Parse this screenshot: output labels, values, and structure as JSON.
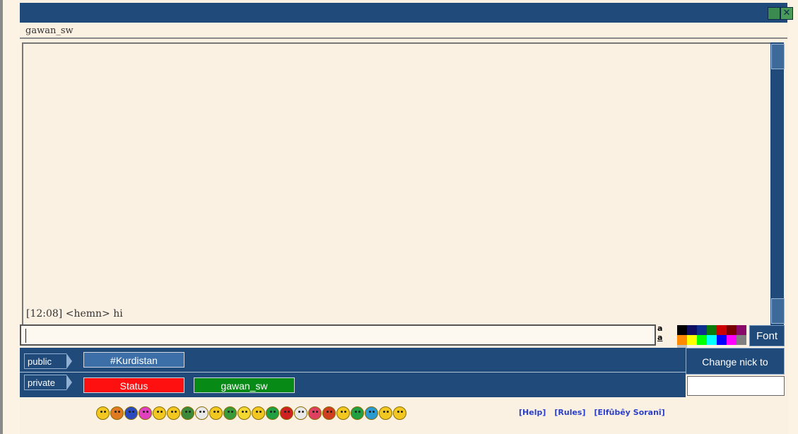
{
  "window": {
    "nick_title": "gawan_sw",
    "maximize_icon": "maximize-icon",
    "close_glyph": "✕"
  },
  "chat": {
    "lines": [
      "[12:08] <hemn> hi"
    ]
  },
  "format": {
    "aa_top": "a",
    "aa_bottom": "a",
    "font_label": "Font",
    "palette": [
      "#000000",
      "#101060",
      "#0f2f8f",
      "#0a7a0a",
      "#cc0000",
      "#7a0000",
      "#8a0a6a",
      "#ff8a00",
      "#ffff00",
      "#00ff00",
      "#00ffff",
      "#0000ff",
      "#ff00ff",
      "#808080",
      "#c0c0c0"
    ]
  },
  "channels": {
    "public_label": "public",
    "private_label": "private",
    "public_tabs": [
      "#Kurdistan"
    ],
    "private_tabs": [
      "Status",
      "gawan_sw"
    ]
  },
  "nick": {
    "change_label": "Change nick to",
    "input_value": ""
  },
  "smileys": [
    "#f2c820",
    "#e07a20",
    "#2a4ac0",
    "#e040c0",
    "#f2c820",
    "#f2c820",
    "#3a8a3a",
    "#e8e8e8",
    "#f2c820",
    "#3a9a3a",
    "#f2d830",
    "#f2c820",
    "#20a040",
    "#d02020",
    "#e8e8e8",
    "#e04060",
    "#d04020",
    "#f2c820",
    "#20a040",
    "#2a9ad0",
    "#f2c820",
    "#f2c820"
  ],
  "links": [
    "[Help]",
    "[Rules]",
    "[Elfûbêy Soranî]"
  ]
}
